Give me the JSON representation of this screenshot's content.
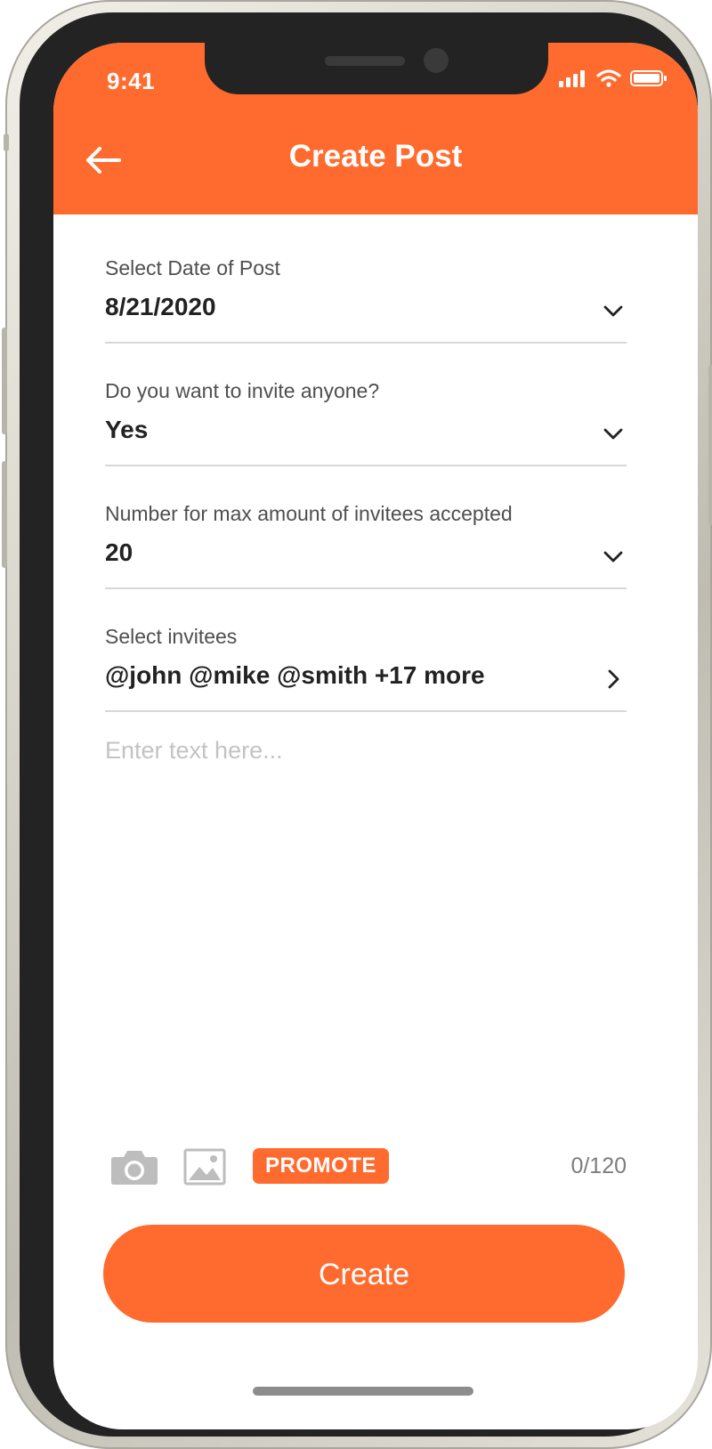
{
  "status_bar": {
    "time": "9:41"
  },
  "header": {
    "title": "Create Post",
    "back_icon": "arrow-left-icon"
  },
  "fields": [
    {
      "label": "Select Date of Post",
      "value": "8/21/2020",
      "icon": "chevron-down-icon"
    },
    {
      "label": "Do you want to invite anyone?",
      "value": "Yes",
      "icon": "chevron-down-icon"
    },
    {
      "label": "Number for max amount of invitees accepted",
      "value": "20",
      "icon": "chevron-down-icon"
    },
    {
      "label": "Select invitees",
      "value": "@john @mike @smith +17 more",
      "icon": "chevron-right-icon"
    }
  ],
  "post_text": {
    "value": "",
    "placeholder": "Enter text here..."
  },
  "toolbar": {
    "promote_label": "PROMOTE",
    "counter": "0/120"
  },
  "create_button": {
    "label": "Create"
  },
  "colors": {
    "accent": "#FF6B2E",
    "text": "#222222",
    "muted": "#7d7d7d",
    "divider": "#d7d7d7"
  }
}
